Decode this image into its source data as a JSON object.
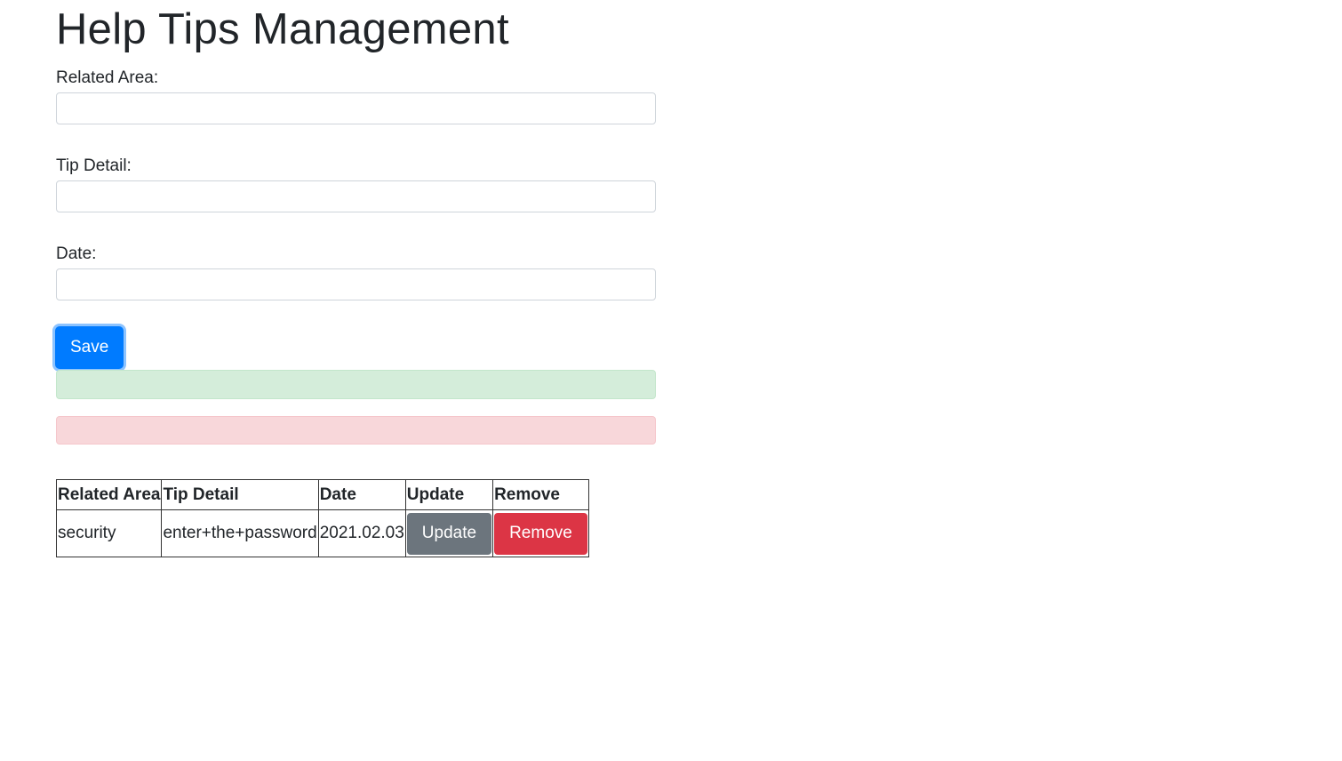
{
  "page": {
    "title": "Help Tips Management"
  },
  "form": {
    "related_area": {
      "label": "Related Area:",
      "value": ""
    },
    "tip_detail": {
      "label": "Tip Detail:",
      "value": ""
    },
    "date": {
      "label": "Date:",
      "value": ""
    },
    "save_label": "Save"
  },
  "alerts": {
    "success_text": "",
    "error_text": ""
  },
  "table": {
    "headers": [
      "Related Area",
      "Tip Detail",
      "Date",
      "Update",
      "Remove"
    ],
    "rows": [
      {
        "related_area": "security",
        "tip_detail": "enter+the+password",
        "date": "2021.02.03",
        "update_label": "Update",
        "remove_label": "Remove"
      }
    ]
  },
  "colors": {
    "primary": "#007bff",
    "secondary": "#6c757d",
    "danger": "#dc3545",
    "success_bg": "#d4edda",
    "danger_bg": "#f8d7da"
  }
}
